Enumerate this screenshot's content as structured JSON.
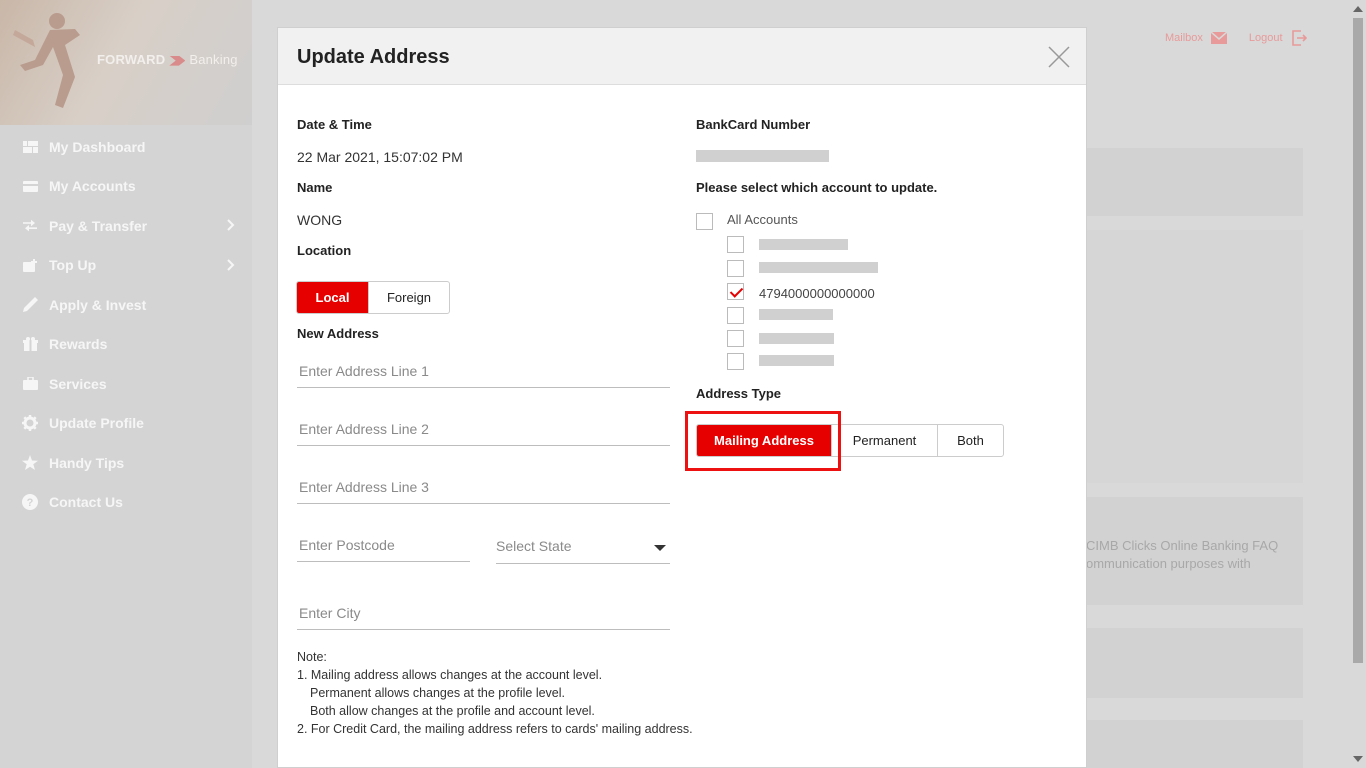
{
  "sidebar": {
    "brand": {
      "primary": "FORWARD",
      "secondary": "Banking"
    },
    "items": [
      {
        "label": "My Dashboard",
        "icon": "dashboard-icon"
      },
      {
        "label": "My Accounts",
        "icon": "card-icon"
      },
      {
        "label": "Pay & Transfer",
        "icon": "transfer-icon",
        "has_submenu": true
      },
      {
        "label": "Top Up",
        "icon": "topup-icon",
        "has_submenu": true
      },
      {
        "label": "Apply & Invest",
        "icon": "pen-icon"
      },
      {
        "label": "Rewards",
        "icon": "gift-icon"
      },
      {
        "label": "Services",
        "icon": "briefcase-icon"
      },
      {
        "label": "Update Profile",
        "icon": "gear-icon"
      },
      {
        "label": "Handy Tips",
        "icon": "star-icon"
      },
      {
        "label": "Contact Us",
        "icon": "help-icon"
      }
    ]
  },
  "header": {
    "mailbox_label": "Mailbox",
    "logout_label": "Logout"
  },
  "background": {
    "faq_line1": "CIMB Clicks Online Banking FAQ",
    "faq_line2": "ommunication purposes with"
  },
  "modal": {
    "title": "Update Address",
    "date_label": "Date & Time",
    "date_value": "22 Mar 2021, 15:07:02 PM",
    "name_label": "Name",
    "name_value": "WONG",
    "location_label": "Location",
    "location_options": [
      "Local",
      "Foreign"
    ],
    "location_selected": "Local",
    "new_address_label": "New Address",
    "placeholders": {
      "line1": "Enter Address Line 1",
      "line2": "Enter Address Line 2",
      "line3": "Enter Address Line 3",
      "postcode": "Enter Postcode",
      "state": "Select State",
      "city": "Enter City"
    },
    "note": {
      "title": "Note:",
      "lines": [
        "1. Mailing address allows changes at the account level.",
        "Permanent allows changes at the profile level.",
        "Both allow changes at the profile and account level.",
        "2. For Credit Card, the mailing address refers to cards' mailing address."
      ]
    },
    "bankcard_label": "BankCard Number",
    "select_account_label": "Please select which account to update.",
    "all_accounts_label": "All Accounts",
    "accounts": [
      {
        "number": "",
        "checked": false
      },
      {
        "number": "",
        "checked": false
      },
      {
        "number": "4794000000000000",
        "checked": true
      },
      {
        "number": "",
        "checked": false
      },
      {
        "number": "",
        "checked": false
      },
      {
        "number": "",
        "checked": false
      }
    ],
    "address_type_label": "Address Type",
    "address_type_options": [
      "Mailing Address",
      "Permanent",
      "Both"
    ],
    "address_type_selected": "Mailing Address"
  },
  "colors": {
    "accent": "#e60000",
    "sidebar_bg": "#d4d4d4",
    "overlay": "#d9d9d9"
  }
}
